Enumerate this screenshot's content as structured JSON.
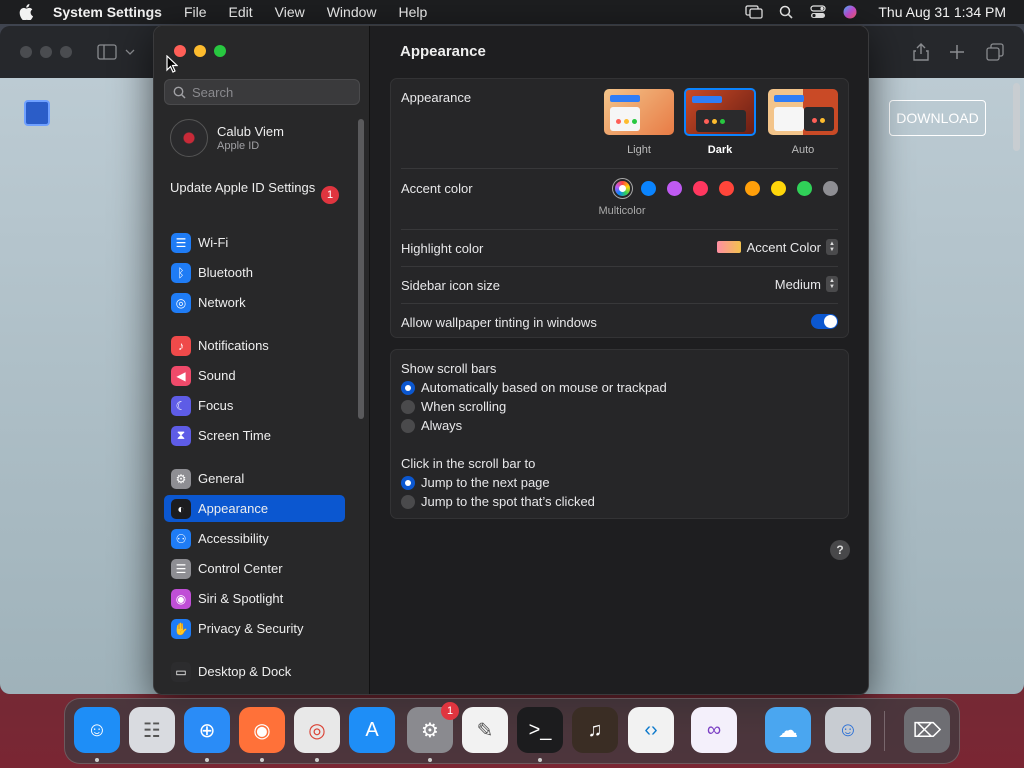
{
  "menubar": {
    "app_name": "System Settings",
    "menus": [
      "File",
      "Edit",
      "View",
      "Window",
      "Help"
    ],
    "clock": "Thu Aug 31  1:34 PM"
  },
  "browser": {
    "download_label": "DOWNLOAD"
  },
  "sidebar": {
    "search_placeholder": "Search",
    "account": {
      "name": "Calub Viem",
      "subtitle": "Apple ID"
    },
    "update": {
      "label": "Update Apple ID Settings",
      "badge": "1"
    },
    "items": [
      {
        "label": "Wi-Fi",
        "icon": "wifi-icon",
        "color": "#1f7cf5"
      },
      {
        "label": "Bluetooth",
        "icon": "bluetooth-icon",
        "color": "#1f7cf5"
      },
      {
        "label": "Network",
        "icon": "globe-icon",
        "color": "#1f7cf5"
      },
      {
        "label": "Notifications",
        "icon": "bell-icon",
        "color": "#ef4a4a"
      },
      {
        "label": "Sound",
        "icon": "speaker-icon",
        "color": "#ef4a6a"
      },
      {
        "label": "Focus",
        "icon": "moon-icon",
        "color": "#5e5ce6"
      },
      {
        "label": "Screen Time",
        "icon": "hourglass-icon",
        "color": "#5e5ce6"
      },
      {
        "label": "General",
        "icon": "gear-icon",
        "color": "#8e8e93"
      },
      {
        "label": "Appearance",
        "icon": "appearance-icon",
        "color": "#1c1c1e",
        "active": true
      },
      {
        "label": "Accessibility",
        "icon": "accessibility-icon",
        "color": "#1f7cf5"
      },
      {
        "label": "Control Center",
        "icon": "control-center-icon",
        "color": "#8e8e93"
      },
      {
        "label": "Siri & Spotlight",
        "icon": "siri-icon",
        "color": "#c04fd6"
      },
      {
        "label": "Privacy & Security",
        "icon": "hand-icon",
        "color": "#1f7cf5"
      },
      {
        "label": "Desktop & Dock",
        "icon": "dock-icon",
        "color": "#2c2c2e"
      }
    ]
  },
  "main": {
    "title": "Appearance",
    "appearance": {
      "label": "Appearance",
      "options": [
        "Light",
        "Dark",
        "Auto"
      ],
      "selected": "Dark"
    },
    "accent": {
      "label": "Accent color",
      "selected_name": "Multicolor",
      "colors": [
        "#ff5f57",
        "#0a84ff",
        "#bf5af2",
        "#ff375f",
        "#ff453a",
        "#ff9f0a",
        "#ffd60a",
        "#30d158",
        "#8e8e93"
      ]
    },
    "highlight": {
      "label": "Highlight color",
      "value": "Accent Color"
    },
    "sidebar_size": {
      "label": "Sidebar icon size",
      "value": "Medium"
    },
    "tinting": {
      "label": "Allow wallpaper tinting in windows",
      "on": true
    },
    "scroll_bars": {
      "label": "Show scroll bars",
      "options": [
        "Automatically based on mouse or trackpad",
        "When scrolling",
        "Always"
      ],
      "selected": 0
    },
    "click_scroll": {
      "label": "Click in the scroll bar to",
      "options": [
        "Jump to the next page",
        "Jump to the spot that’s clicked"
      ],
      "selected": 0
    },
    "help_label": "?"
  },
  "dock": {
    "apps": [
      {
        "name": "finder-icon",
        "color": "#1e8ef7"
      },
      {
        "name": "launchpad-icon",
        "color": "#d9dbe0"
      },
      {
        "name": "safari-icon",
        "color": "#2a8cf7"
      },
      {
        "name": "firefox-icon",
        "color": "#ff7139"
      },
      {
        "name": "chrome-icon",
        "color": "#e8e8e8"
      },
      {
        "name": "app-store-icon",
        "color": "#1e8ef7"
      },
      {
        "name": "system-settings-icon",
        "color": "#8a8a8f"
      },
      {
        "name": "textedit-icon",
        "color": "#f2f2f2"
      },
      {
        "name": "terminal-icon",
        "color": "#1c1c1e"
      },
      {
        "name": "garageband-icon",
        "color": "#3a2d24"
      },
      {
        "name": "vscode-icon",
        "color": "#f2f2f2"
      },
      {
        "name": "visual-studio-icon",
        "color": "#f4f0fb"
      },
      {
        "name": "weather-icon",
        "color": "#4aa6f0"
      },
      {
        "name": "preview-icon",
        "color": "#c8ccd2"
      },
      {
        "name": "trash-icon",
        "color": "#6e6e73"
      }
    ],
    "settings_badge": "1"
  }
}
